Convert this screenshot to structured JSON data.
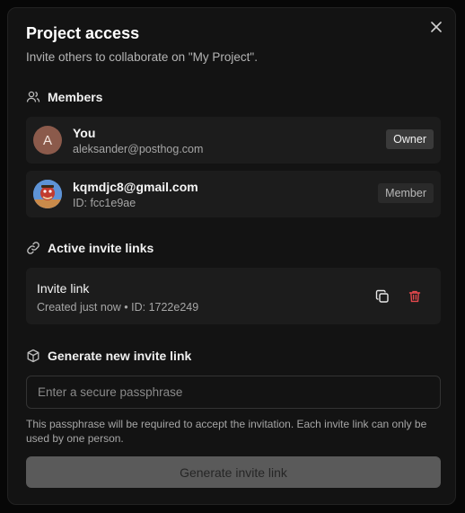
{
  "dialog": {
    "title": "Project access",
    "subtitle": "Invite others to collaborate on \"My Project\"."
  },
  "members": {
    "heading": "Members",
    "items": [
      {
        "name": "You",
        "sub": "aleksander@posthog.com",
        "role": "Owner",
        "avatar_letter": "A"
      },
      {
        "name": "kqmdjc8@gmail.com",
        "sub": "ID: fcc1e9ae",
        "role": "Member"
      }
    ]
  },
  "invites": {
    "heading": "Active invite links",
    "items": [
      {
        "title": "Invite link",
        "sub": "Created just now • ID: 1722e249"
      }
    ]
  },
  "generate": {
    "heading": "Generate new invite link",
    "placeholder": "Enter a secure passphrase",
    "help": "This passphrase will be required to accept the invitation. Each invite link can only be used by one person.",
    "button_label": "Generate invite link"
  },
  "icons": {
    "close": "close-icon",
    "members": "users-icon",
    "links": "link-icon",
    "generate": "box-icon",
    "copy": "copy-icon",
    "delete": "trash-icon"
  },
  "colors": {
    "delete": "#e5484d",
    "button_disabled": "#5a5a5a"
  }
}
